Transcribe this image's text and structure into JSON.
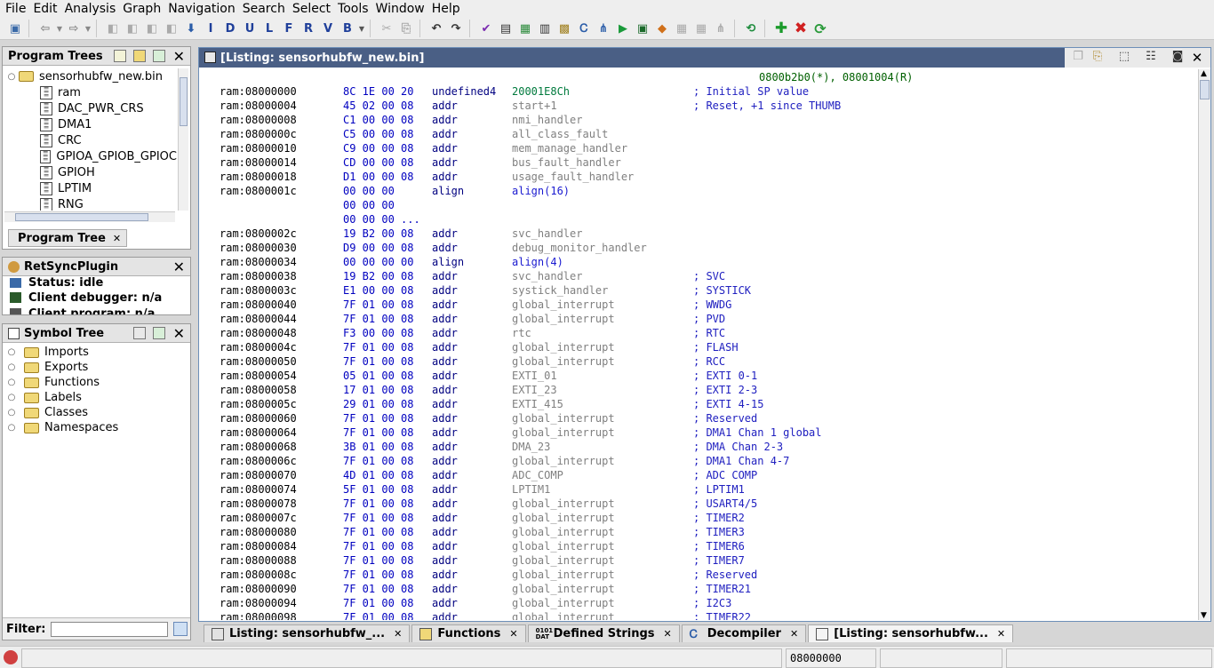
{
  "menu": [
    "File",
    "Edit",
    "Analysis",
    "Graph",
    "Navigation",
    "Search",
    "Select",
    "Tools",
    "Window",
    "Help"
  ],
  "toolbar": {
    "letters": [
      "I",
      "D",
      "U",
      "L",
      "F",
      "R",
      "V",
      "B"
    ]
  },
  "program_trees": {
    "title": "Program Trees",
    "root": "sensorhubfw_new.bin",
    "items": [
      "ram",
      "DAC_PWR_CRS",
      "DMA1",
      "CRC",
      "GPIOA_GPIOB_GPIOC",
      "GPIOH",
      "LPTIM",
      "RNG"
    ],
    "tab_label": "Program Tree"
  },
  "retsync": {
    "title": "RetSyncPlugin",
    "status": "Status: idle",
    "client_debugger": "Client debugger: n/a",
    "client_program": "Client program: n/a"
  },
  "symbol_tree": {
    "title": "Symbol Tree",
    "items": [
      "Imports",
      "Exports",
      "Functions",
      "Labels",
      "Classes",
      "Namespaces"
    ],
    "filter_label": "Filter:",
    "filter_value": ""
  },
  "listing": {
    "title": "[Listing:  sensorhubfw_new.bin]",
    "xref_top": "0800b2b0(*), 08001004(R)",
    "rows": [
      {
        "addr": "ram:08000000",
        "bytes": "8C 1E 00 20",
        "mn": "undefined4",
        "op": "20001E8Ch",
        "cm": "; Initial SP value"
      },
      {
        "addr": "ram:08000004",
        "bytes": "45 02 00 08",
        "mn": "addr",
        "op": "start+1",
        "cm": "; Reset, +1 since THUMB"
      },
      {
        "addr": "ram:08000008",
        "bytes": "C1 00 00 08",
        "mn": "addr",
        "op": "nmi_handler",
        "cm": ""
      },
      {
        "addr": "ram:0800000c",
        "bytes": "C5 00 00 08",
        "mn": "addr",
        "op": "all_class_fault",
        "cm": ""
      },
      {
        "addr": "ram:08000010",
        "bytes": "C9 00 00 08",
        "mn": "addr",
        "op": "mem_manage_handler",
        "cm": ""
      },
      {
        "addr": "ram:08000014",
        "bytes": "CD 00 00 08",
        "mn": "addr",
        "op": "bus_fault_handler",
        "cm": ""
      },
      {
        "addr": "ram:08000018",
        "bytes": "D1 00 00 08",
        "mn": "addr",
        "op": "usage_fault_handler",
        "cm": ""
      },
      {
        "addr": "ram:0800001c",
        "bytes": "00 00 00",
        "mn": "align",
        "op": "align(16)",
        "cm": ""
      },
      {
        "addr": "",
        "bytes": "00 00 00",
        "mn": "",
        "op": "",
        "cm": ""
      },
      {
        "addr": "",
        "bytes": "00 00 00 ...",
        "mn": "",
        "op": "",
        "cm": ""
      },
      {
        "addr": "ram:0800002c",
        "bytes": "19 B2 00 08",
        "mn": "addr",
        "op": "svc_handler",
        "cm": ""
      },
      {
        "addr": "ram:08000030",
        "bytes": "D9 00 00 08",
        "mn": "addr",
        "op": "debug_monitor_handler",
        "cm": ""
      },
      {
        "addr": "ram:08000034",
        "bytes": "00 00 00 00",
        "mn": "align",
        "op": "align(4)",
        "cm": ""
      },
      {
        "addr": "ram:08000038",
        "bytes": "19 B2 00 08",
        "mn": "addr",
        "op": "svc_handler",
        "cm": "; SVC"
      },
      {
        "addr": "ram:0800003c",
        "bytes": "E1 00 00 08",
        "mn": "addr",
        "op": "systick_handler",
        "cm": "; SYSTICK"
      },
      {
        "addr": "ram:08000040",
        "bytes": "7F 01 00 08",
        "mn": "addr",
        "op": "global_interrupt",
        "cm": "; WWDG"
      },
      {
        "addr": "ram:08000044",
        "bytes": "7F 01 00 08",
        "mn": "addr",
        "op": "global_interrupt",
        "cm": "; PVD"
      },
      {
        "addr": "ram:08000048",
        "bytes": "F3 00 00 08",
        "mn": "addr",
        "op": "rtc",
        "cm": "; RTC"
      },
      {
        "addr": "ram:0800004c",
        "bytes": "7F 01 00 08",
        "mn": "addr",
        "op": "global_interrupt",
        "cm": "; FLASH"
      },
      {
        "addr": "ram:08000050",
        "bytes": "7F 01 00 08",
        "mn": "addr",
        "op": "global_interrupt",
        "cm": "; RCC"
      },
      {
        "addr": "ram:08000054",
        "bytes": "05 01 00 08",
        "mn": "addr",
        "op": "EXTI_01",
        "cm": "; EXTI 0-1"
      },
      {
        "addr": "ram:08000058",
        "bytes": "17 01 00 08",
        "mn": "addr",
        "op": "EXTI_23",
        "cm": "; EXTI 2-3"
      },
      {
        "addr": "ram:0800005c",
        "bytes": "29 01 00 08",
        "mn": "addr",
        "op": "EXTI_415",
        "cm": "; EXTI 4-15"
      },
      {
        "addr": "ram:08000060",
        "bytes": "7F 01 00 08",
        "mn": "addr",
        "op": "global_interrupt",
        "cm": "; Reserved"
      },
      {
        "addr": "ram:08000064",
        "bytes": "7F 01 00 08",
        "mn": "addr",
        "op": "global_interrupt",
        "cm": "; DMA1 Chan 1 global"
      },
      {
        "addr": "ram:08000068",
        "bytes": "3B 01 00 08",
        "mn": "addr",
        "op": "DMA_23",
        "cm": "; DMA Chan 2-3"
      },
      {
        "addr": "ram:0800006c",
        "bytes": "7F 01 00 08",
        "mn": "addr",
        "op": "global_interrupt",
        "cm": "; DMA1 Chan 4-7"
      },
      {
        "addr": "ram:08000070",
        "bytes": "4D 01 00 08",
        "mn": "addr",
        "op": "ADC_COMP",
        "cm": "; ADC COMP"
      },
      {
        "addr": "ram:08000074",
        "bytes": "5F 01 00 08",
        "mn": "addr",
        "op": "LPTIM1",
        "cm": "; LPTIM1"
      },
      {
        "addr": "ram:08000078",
        "bytes": "7F 01 00 08",
        "mn": "addr",
        "op": "global_interrupt",
        "cm": "; USART4/5"
      },
      {
        "addr": "ram:0800007c",
        "bytes": "7F 01 00 08",
        "mn": "addr",
        "op": "global_interrupt",
        "cm": "; TIMER2"
      },
      {
        "addr": "ram:08000080",
        "bytes": "7F 01 00 08",
        "mn": "addr",
        "op": "global_interrupt",
        "cm": "; TIMER3"
      },
      {
        "addr": "ram:08000084",
        "bytes": "7F 01 00 08",
        "mn": "addr",
        "op": "global_interrupt",
        "cm": "; TIMER6"
      },
      {
        "addr": "ram:08000088",
        "bytes": "7F 01 00 08",
        "mn": "addr",
        "op": "global_interrupt",
        "cm": "; TIMER7"
      },
      {
        "addr": "ram:0800008c",
        "bytes": "7F 01 00 08",
        "mn": "addr",
        "op": "global_interrupt",
        "cm": "; Reserved"
      },
      {
        "addr": "ram:08000090",
        "bytes": "7F 01 00 08",
        "mn": "addr",
        "op": "global_interrupt",
        "cm": "; TIMER21"
      },
      {
        "addr": "ram:08000094",
        "bytes": "7F 01 00 08",
        "mn": "addr",
        "op": "global_interrupt",
        "cm": "; I2C3"
      },
      {
        "addr": "ram:08000098",
        "bytes": "7F 01 00 08",
        "mn": "addr",
        "op": "global_interrupt",
        "cm": "; TIMER22"
      }
    ]
  },
  "bottom_tabs": [
    {
      "label": "Listing:  sensorhubfw_..."
    },
    {
      "label": "Functions"
    },
    {
      "label": "Defined Strings"
    },
    {
      "label": "Decompiler"
    },
    {
      "label": "[Listing:  sensorhubfw..."
    }
  ],
  "statusbar": {
    "address": "08000000"
  }
}
